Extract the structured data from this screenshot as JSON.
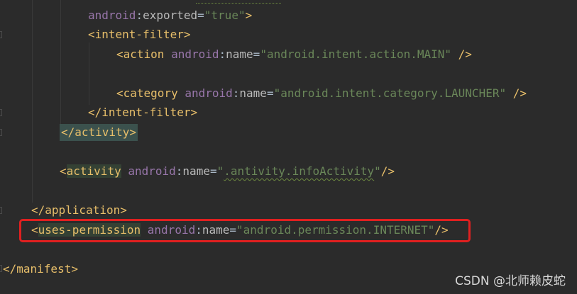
{
  "code": {
    "line_exported": {
      "ns": "android",
      "attr": "exported",
      "eq": "=",
      "value": "\"true\"",
      "close": ">"
    },
    "line_intent_open": {
      "text": "<intent-filter>"
    },
    "line_action": {
      "open": "<action ",
      "ns": "android",
      "attr": "name",
      "eq": "=",
      "value": "\"android.intent.action.MAIN\"",
      "close": " />"
    },
    "line_category": {
      "open": "<category ",
      "ns": "android",
      "attr": "name",
      "eq": "=",
      "value": "\"android.intent.category.LAUNCHER\"",
      "close": " />"
    },
    "line_intent_close": {
      "text": "</intent-filter>"
    },
    "line_activity_close": {
      "text": "</activity>"
    },
    "line_activity2": {
      "lt": "<",
      "tag": "activity",
      "sp": " ",
      "ns": "android",
      "attr": "name",
      "eq": "=",
      "value_q1": "\"",
      "value_main": ".antivity.infoActivity",
      "value_q2": "\"",
      "close": "/>"
    },
    "line_application_close": {
      "text": "</application>"
    },
    "line_permission": {
      "lt": "<",
      "tag": "uses-permission",
      "sp": " ",
      "ns": "android",
      "attr": "name",
      "eq": "=",
      "value": "\"android.permission.INTERNET\"",
      "close": "/>"
    },
    "line_manifest_close": {
      "text": "</manifest>"
    },
    "colon": ":"
  },
  "watermark": "CSDN @北师赖皮蛇",
  "colors": {
    "background": "#2b2b2b",
    "tag": "#e8bf6a",
    "namespace": "#9876aa",
    "string": "#6a8759",
    "highlight_box": "#e02020"
  }
}
